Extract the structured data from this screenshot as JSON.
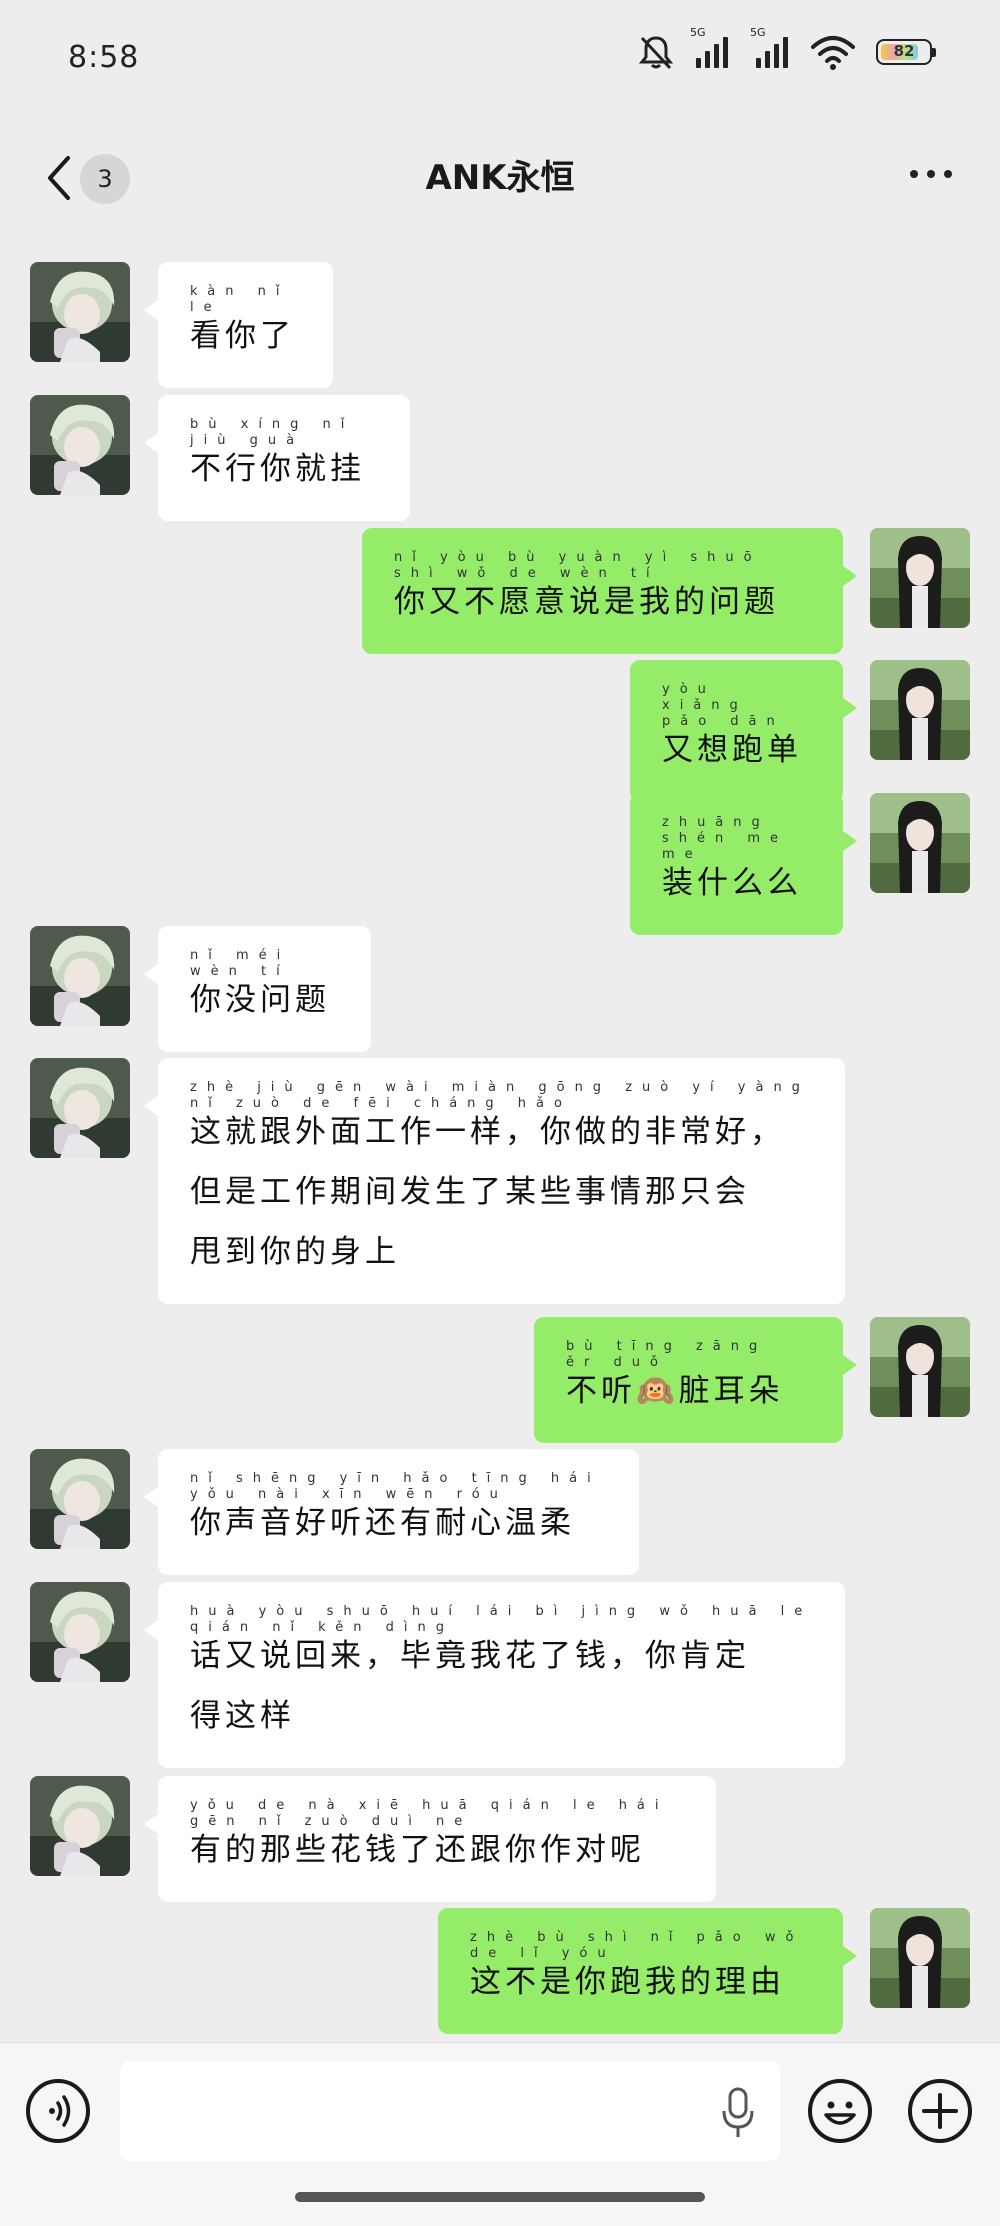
{
  "status_bar": {
    "time": "8:58",
    "network_1": "5G",
    "network_2": "5G",
    "battery": "82"
  },
  "nav": {
    "back_badge": "3",
    "title": "ANK永恒"
  },
  "messages": [
    {
      "side": "other",
      "pinyin": "kàn nǐ le",
      "text": "看你了"
    },
    {
      "side": "other",
      "pinyin": "bù xíng nǐ jiù guà",
      "text": "不行你就挂"
    },
    {
      "side": "me",
      "pinyin": "nǐ yòu bù yuàn yì shuō shì wǒ de wèn tí",
      "text": "你又不愿意说是我的问题"
    },
    {
      "side": "me",
      "pinyin": "yòu xiǎng pǎo dān",
      "text": "又想跑单"
    },
    {
      "side": "me",
      "pinyin": "zhuāng shén me me",
      "text": "装什么么"
    },
    {
      "side": "other",
      "pinyin": "nǐ méi wèn tí",
      "text": "你没问题"
    },
    {
      "side": "other",
      "pinyin": "zhè jiù gēn wài miàn gōng zuò yí yàng nǐ zuò de fēi cháng hǎo",
      "text": "这就跟外面工作一样，你做的非常好，\n但是工作期间发生了某些事情那只会\n甩到你的身上"
    },
    {
      "side": "me",
      "pinyin": "bù tīng zāng ěr duǒ",
      "text": "不听🙉脏耳朵"
    },
    {
      "side": "other",
      "pinyin": "nǐ shēng yīn hǎo tīng hái yǒu nài xīn wēn róu",
      "text": "你声音好听还有耐心温柔"
    },
    {
      "side": "other",
      "pinyin": "huà yòu shuō huí lái bì jìng wǒ huā le qián nǐ kěn dìng",
      "text": "话又说回来，毕竟我花了钱，你肯定\n得这样"
    },
    {
      "side": "other",
      "pinyin": "yǒu de nà xiē huā qián le hái gēn nǐ zuò duì ne",
      "text": "有的那些花钱了还跟你作对呢"
    },
    {
      "side": "me",
      "pinyin": "zhè bù shì nǐ pǎo wǒ de lǐ yóu",
      "text": "这不是你跑我的理由"
    }
  ],
  "input": {
    "placeholder": ""
  },
  "icons": [
    "mute-icon",
    "signal-icon",
    "wifi-icon",
    "battery-icon",
    "back-icon",
    "more-icon",
    "voice-icon",
    "microphone-icon",
    "emoji-icon",
    "plus-icon"
  ],
  "colors": {
    "background": "#ededed",
    "my_bubble": "#95ec69",
    "their_bubble": "#ffffff"
  }
}
